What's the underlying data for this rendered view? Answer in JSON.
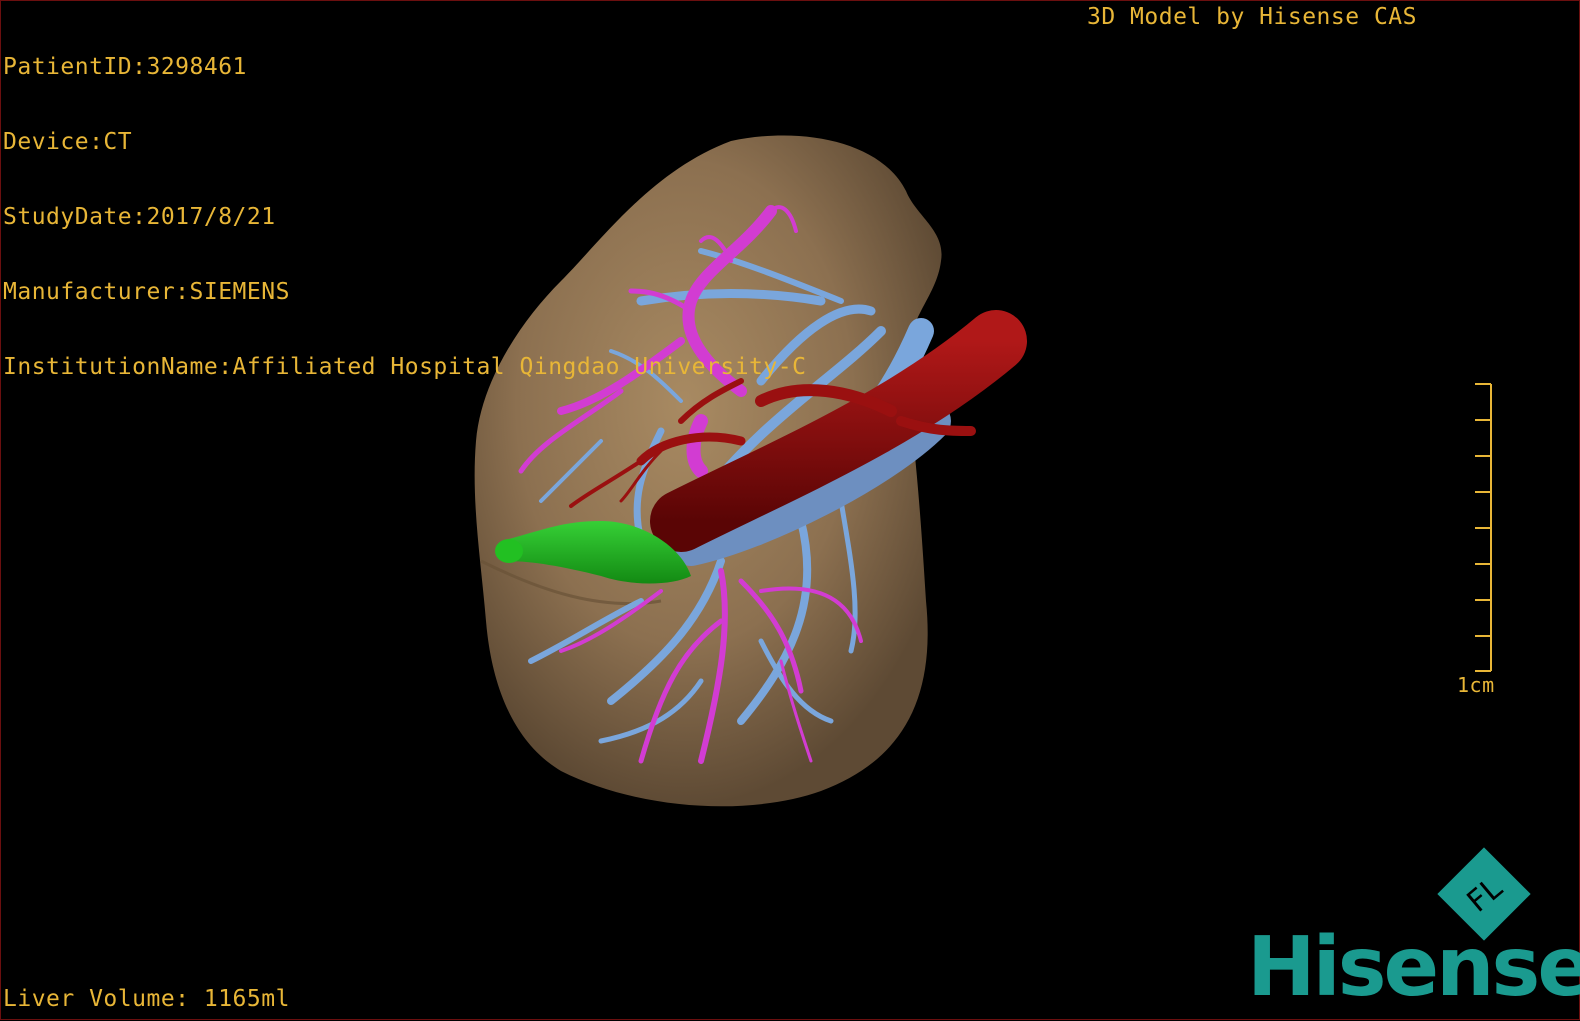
{
  "header": {
    "patient_id": "PatientID:3298461",
    "device": "Device:CT",
    "study_date": "StudyDate:2017/8/21",
    "manufacturer": "Manufacturer:SIEMENS",
    "institution": "InstitutionName:Affiliated Hospital Qingdao University-C"
  },
  "credit": "3D Model by Hisense CAS",
  "footer": {
    "liver_volume": "Liver Volume: 1165ml"
  },
  "scale_bar": {
    "label": "1cm"
  },
  "logo": {
    "word": "Hisense",
    "mark_letters": "FL",
    "color": "#1a9a8f"
  },
  "colors": {
    "overlay_text": "#e8b637",
    "liver": "#8c7050",
    "portal_vein": "#7aa6dc",
    "hepatic_vein": "#d23cd2",
    "artery_ivc": "#8c0a0a",
    "gallbladder": "#1fae1f"
  }
}
